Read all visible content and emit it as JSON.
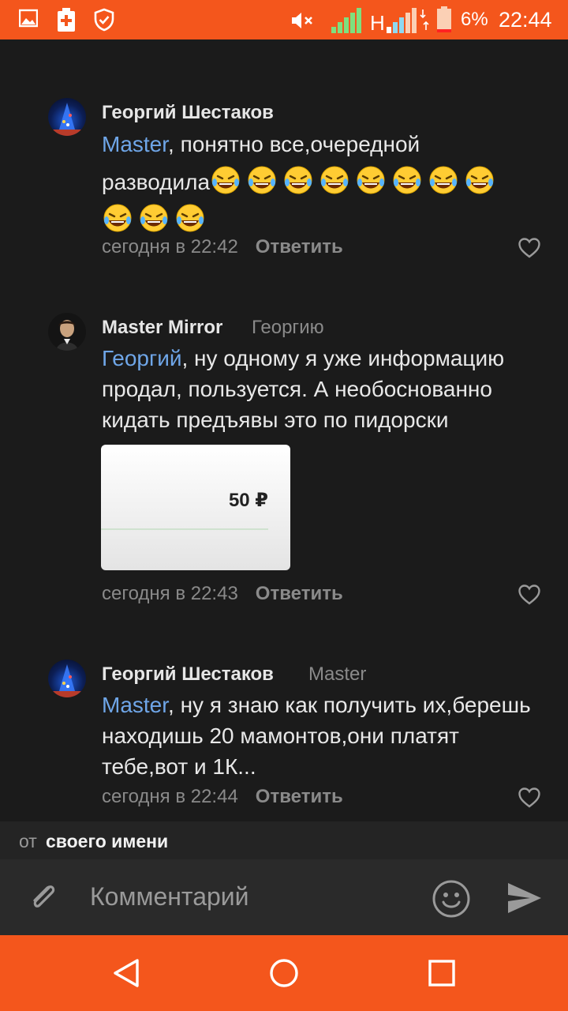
{
  "status_bar": {
    "battery": "6%",
    "time": "22:44",
    "network": "H",
    "icons": [
      "image-icon",
      "battery-plus-icon",
      "shield-check-icon",
      "mute-icon",
      "signal-icon",
      "data-signal-icon",
      "battery-icon"
    ]
  },
  "comments": [
    {
      "author": "Георгий Шестаков",
      "reply_to": "",
      "mention": "Master",
      "text_line1": ", понятно все,очередной",
      "text_line2": "разводила",
      "emoji_count": 11,
      "time": "сегодня в 22:42",
      "reply_label": "Ответить"
    },
    {
      "author": "Master Mirror",
      "reply_to": "Георгию",
      "mention": "Георгий",
      "text": ", ну одному я уже информацию продал, пользуется. А необоснованно кидать предъявы это по пидорски",
      "attachment_price": "50 ₽",
      "time": "сегодня в 22:43",
      "reply_label": "Ответить"
    },
    {
      "author": "Георгий Шестаков",
      "reply_to": "Master",
      "mention": "Master",
      "text": ", ну я знаю как получить их,берешь находишь 20 мамонтов,они платят тебе,вот и 1К...",
      "time": "сегодня в 22:44",
      "reply_label": "Ответить"
    }
  ],
  "from_row": {
    "label": "от",
    "value": "своего имени"
  },
  "composer": {
    "placeholder": "Комментарий"
  },
  "colors": {
    "accent": "#f4561c",
    "mention": "#6fa6e8",
    "background": "#1b1b1b"
  }
}
